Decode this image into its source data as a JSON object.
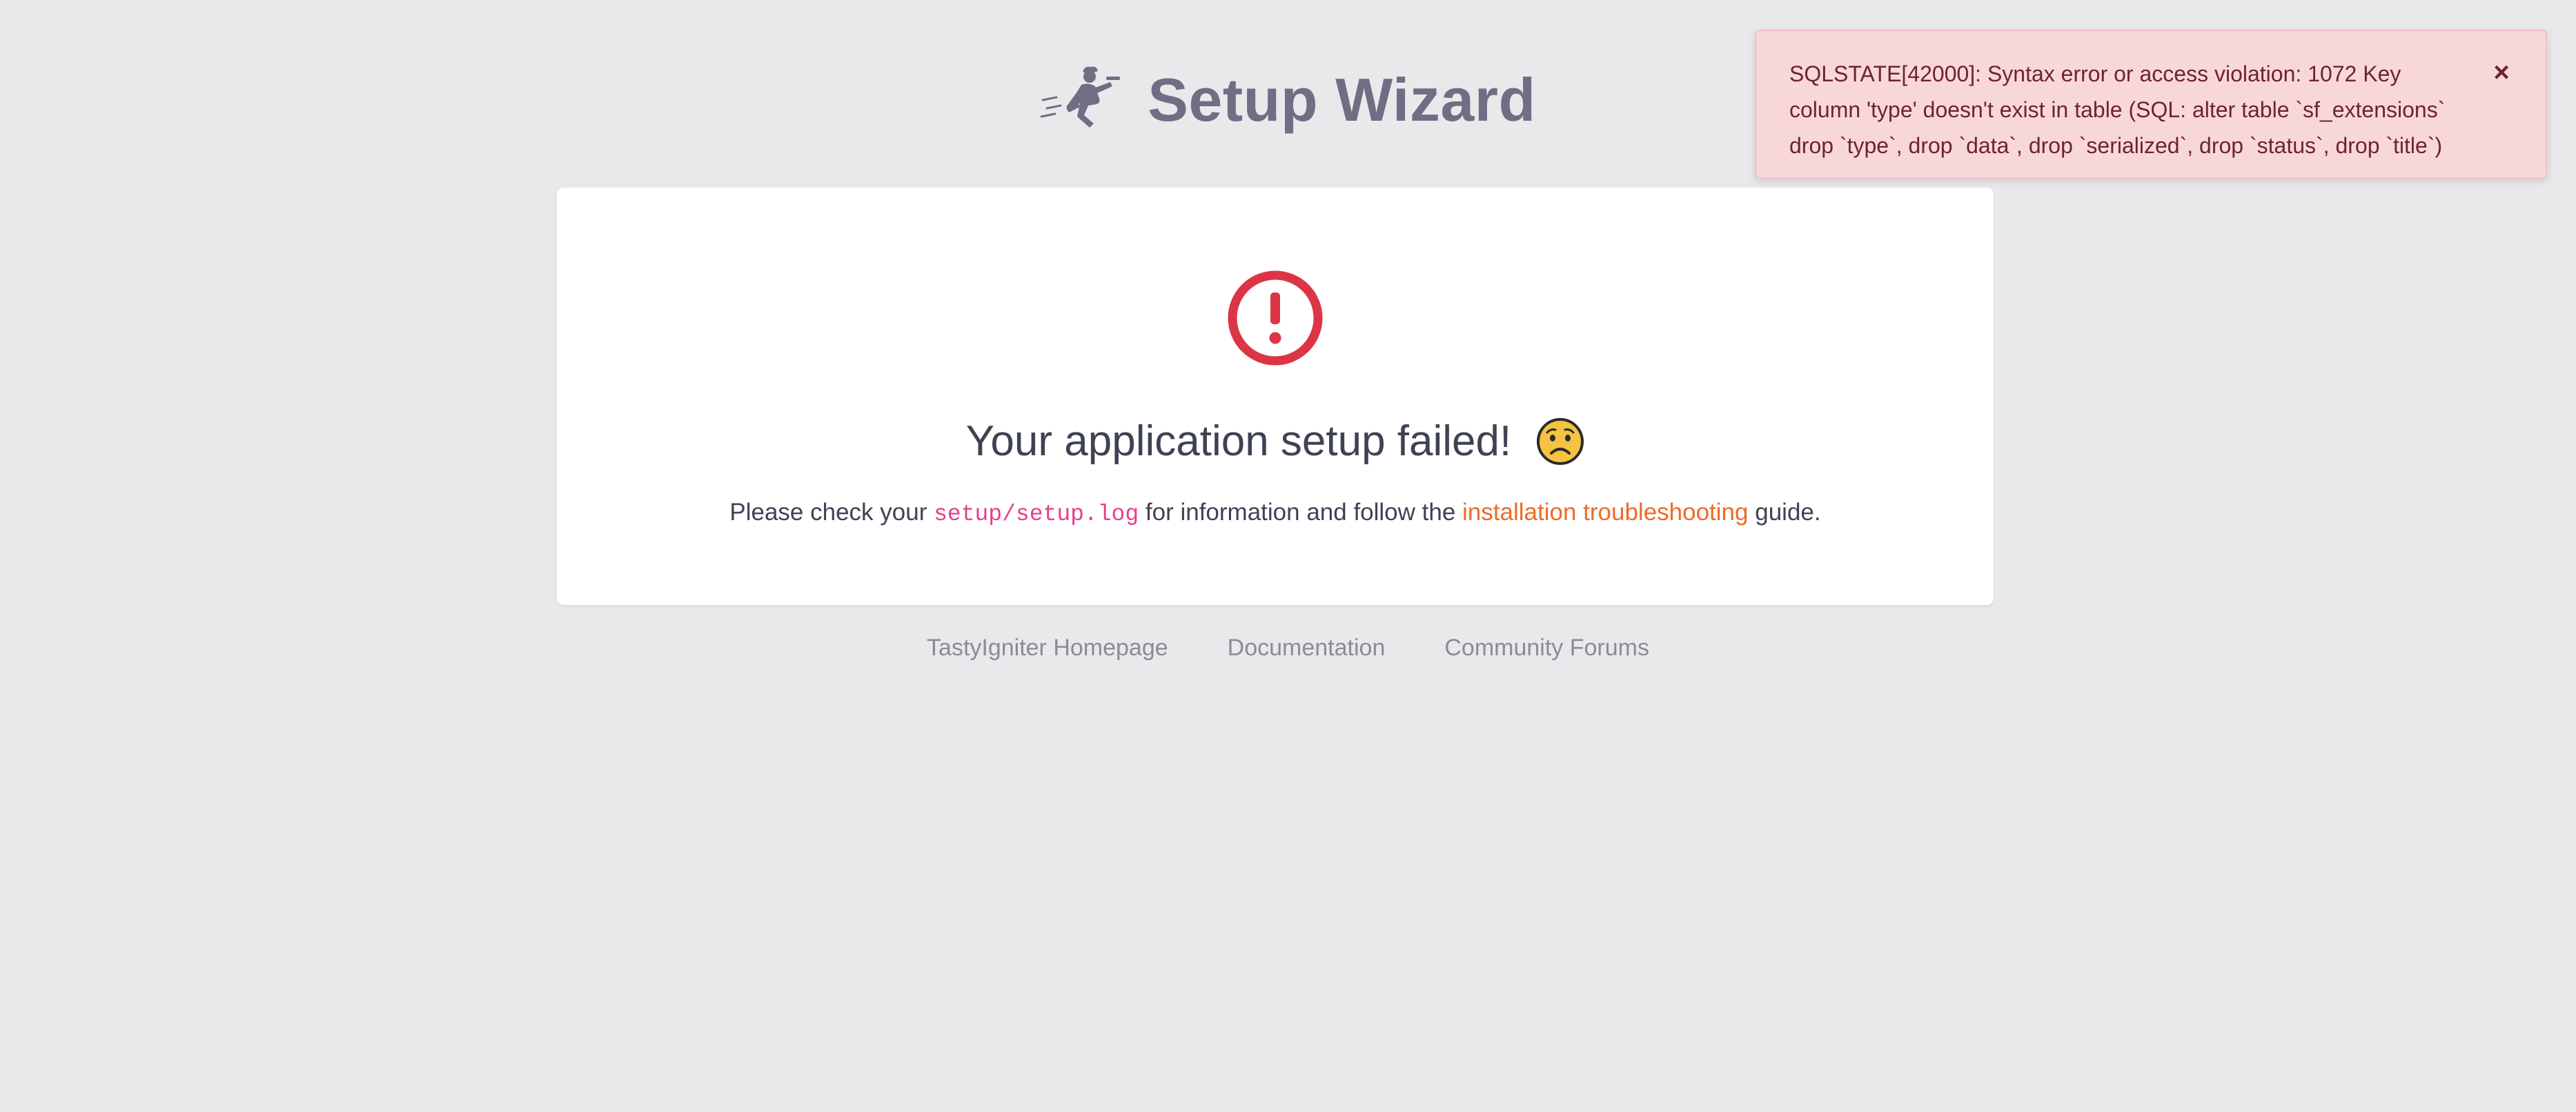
{
  "header": {
    "logo_icon": "running-chef-icon",
    "title": "Setup Wizard"
  },
  "card": {
    "error_icon": "exclamation-circle-icon",
    "fail_title": "Your application setup failed!",
    "fail_emoji": "worried-face-icon",
    "instructions": {
      "prefix": "Please check your",
      "log_path": "setup/setup.log",
      "middle": "for information and follow the",
      "link_text": "installation troubleshooting",
      "suffix": "guide."
    }
  },
  "footer": {
    "links": [
      "TastyIgniter Homepage",
      "Documentation",
      "Community Forums"
    ]
  },
  "toast": {
    "message": "SQLSTATE[42000]: Syntax error or access violation: 1072 Key\ncolumn 'type' doesn't exist in table (SQL: alter table `sf_extensions`\ndrop `type`, drop `data`, drop `serialized`, drop `status`, drop `title`)",
    "close_label": "×"
  },
  "colors": {
    "background": "#e9e9ec",
    "title": "#6f6e84",
    "error_red": "#dc3545",
    "link_orange": "#ee6a28",
    "code_pink": "#e83e8c",
    "toast_bg": "#f8d7da",
    "toast_text": "#6e2330"
  }
}
